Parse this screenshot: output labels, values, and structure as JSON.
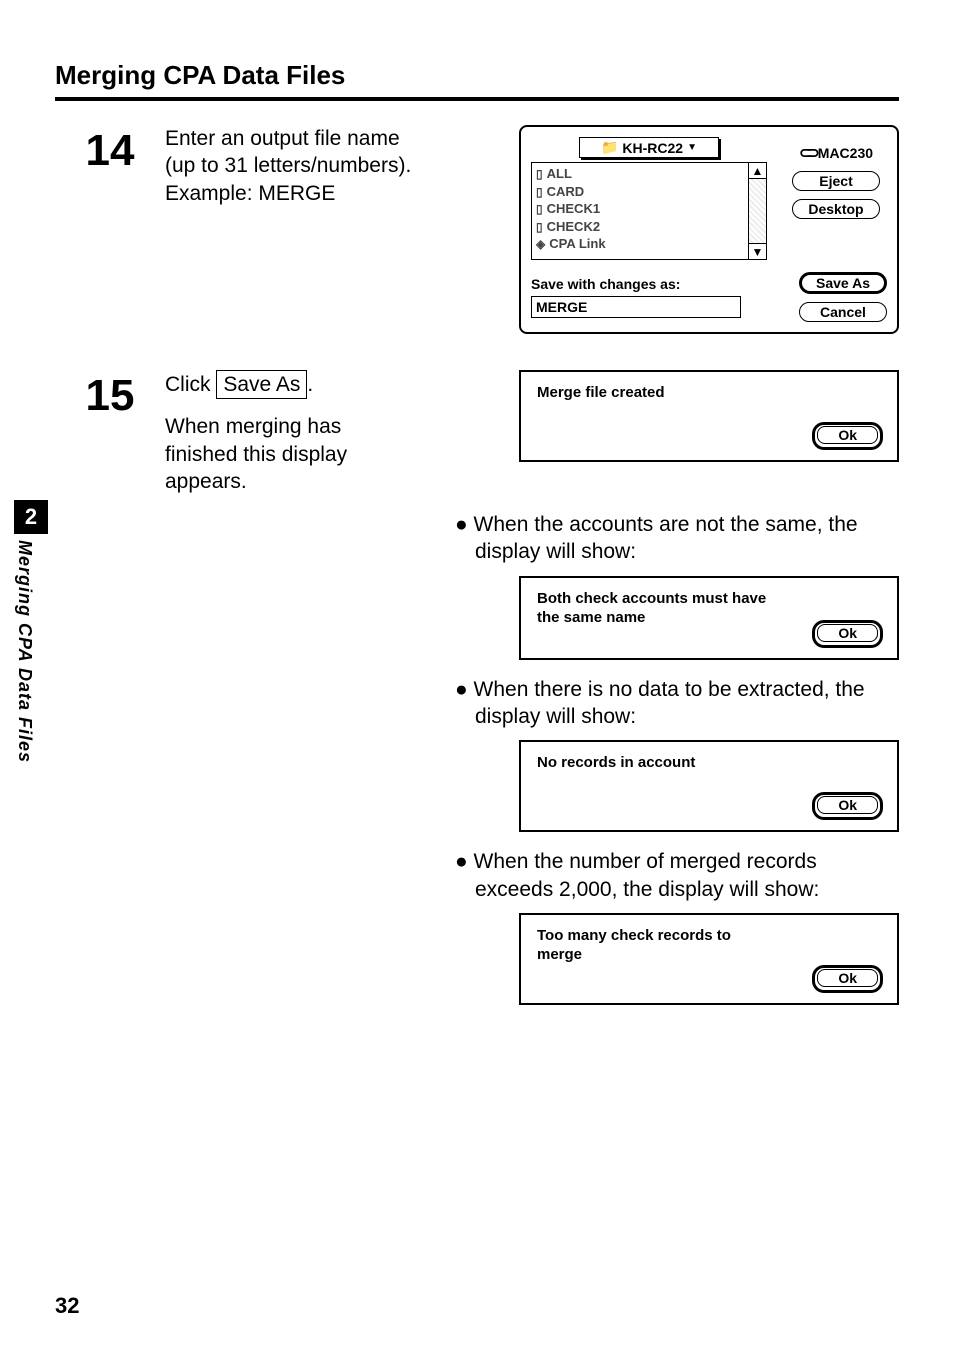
{
  "header": {
    "title": "Merging CPA Data Files"
  },
  "sidetab": {
    "chapter": "2",
    "label": "Merging CPA Data Files"
  },
  "pagenum": "32",
  "step14": {
    "num": "14",
    "text": "Enter an output file name (up to 31 letters/numbers). Example:  MERGE"
  },
  "saveas": {
    "popup": "KH-RC22",
    "files": [
      "ALL",
      "CARD",
      "CHECK1",
      "CHECK2",
      "CPA Link"
    ],
    "drive": "MAC230",
    "eject": "Eject",
    "desktop": "Desktop",
    "save_label": "Save with changes as:",
    "input_value": "MERGE",
    "save_as": "Save As",
    "cancel": "Cancel"
  },
  "step15": {
    "num": "15",
    "click": "Click",
    "click_btn": "Save As",
    "dot": ".",
    "after": "When merging has finished this display appears."
  },
  "dlg_created": {
    "msg": "Merge file created",
    "ok": "Ok"
  },
  "bullet1": "When the accounts are not the same, the display will show:",
  "dlg_same": {
    "msg": "Both check accounts must have the same name",
    "ok": "Ok"
  },
  "bullet2": "When there is no data to be extracted, the display will show:",
  "dlg_none": {
    "msg": "No records in account",
    "ok": "Ok"
  },
  "bullet3": "When the number of merged records exceeds 2,000, the display will show:",
  "dlg_many": {
    "msg": "Too many check records to merge",
    "ok": "Ok"
  }
}
